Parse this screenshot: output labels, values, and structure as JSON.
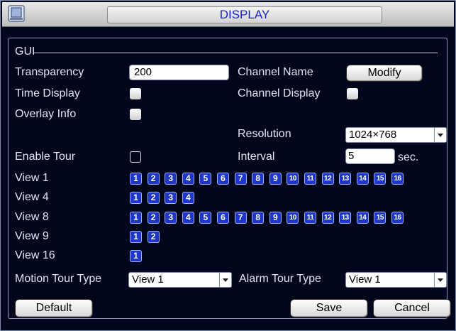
{
  "window": {
    "title": "DISPLAY"
  },
  "gui_section": {
    "label": "GUI"
  },
  "transparency": {
    "label": "Transparency",
    "value": "200"
  },
  "channel_name": {
    "label": "Channel Name",
    "button": "Modify"
  },
  "time_display": {
    "label": "Time Display",
    "checked": true
  },
  "channel_display": {
    "label": "Channel Display",
    "checked": true
  },
  "overlay_info": {
    "label": "Overlay Info",
    "checked": true
  },
  "resolution": {
    "label": "Resolution",
    "value": "1024×768"
  },
  "enable_tour": {
    "label": "Enable Tour",
    "checked": false
  },
  "interval": {
    "label": "Interval",
    "value": "5",
    "unit": "sec."
  },
  "views": [
    {
      "label": "View 1",
      "numbers": [
        "1",
        "2",
        "3",
        "4",
        "5",
        "6",
        "7",
        "8",
        "9",
        "10",
        "11",
        "12",
        "13",
        "14",
        "15",
        "16"
      ]
    },
    {
      "label": "View 4",
      "numbers": [
        "1",
        "2",
        "3",
        "4"
      ]
    },
    {
      "label": "View 8",
      "numbers": [
        "1",
        "2",
        "3",
        "4",
        "5",
        "6",
        "7",
        "8",
        "9",
        "10",
        "11",
        "12",
        "13",
        "14",
        "15",
        "16"
      ]
    },
    {
      "label": "View 9",
      "numbers": [
        "1",
        "2"
      ]
    },
    {
      "label": "View 16",
      "numbers": [
        "1"
      ]
    }
  ],
  "motion_tour_type": {
    "label": "Motion Tour Type",
    "value": "View 1"
  },
  "alarm_tour_type": {
    "label": "Alarm Tour Type",
    "value": "View 1"
  },
  "buttons": {
    "default": "Default",
    "save": "Save",
    "cancel": "Cancel"
  },
  "colors": {
    "background": "#00061c",
    "number_box": "#1f37c8",
    "title_text": "#1424c8"
  }
}
